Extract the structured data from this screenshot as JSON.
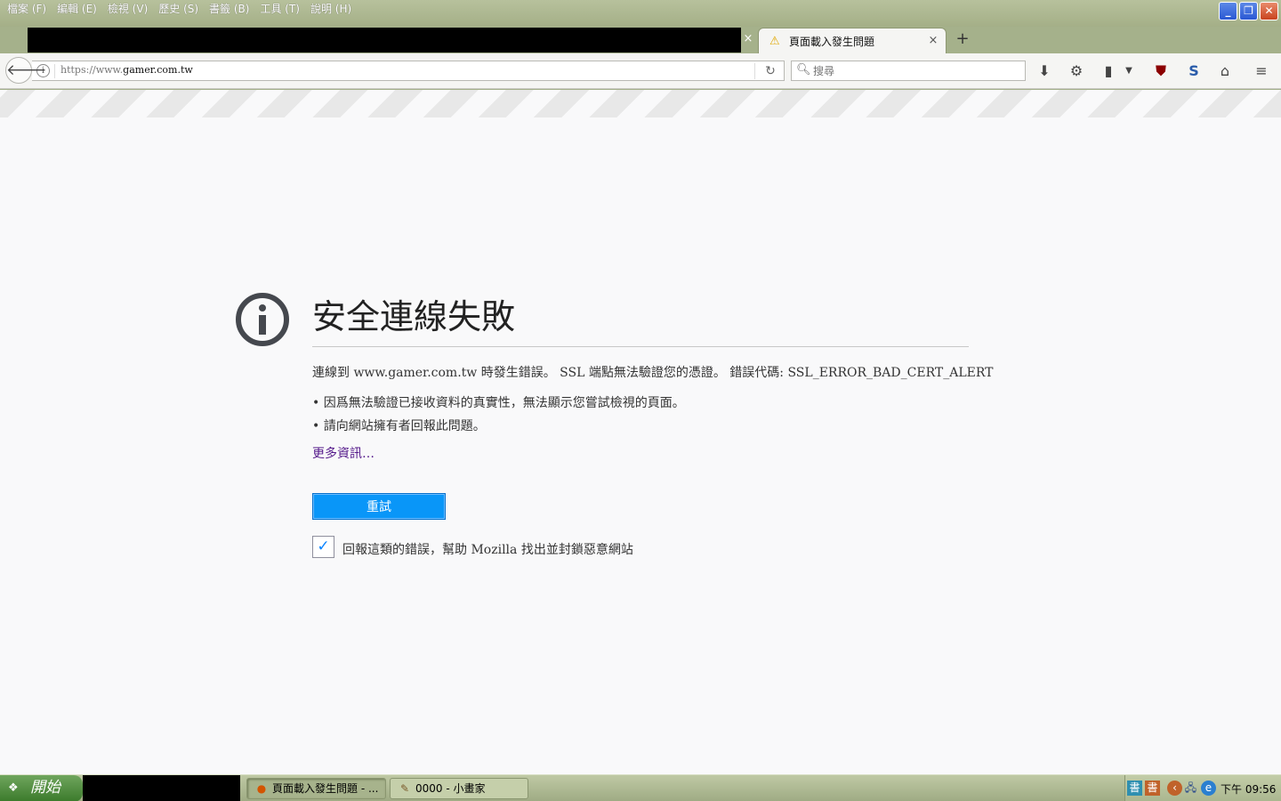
{
  "menu": [
    "檔案 (F)",
    "編輯 (E)",
    "檢視 (V)",
    "歷史 (S)",
    "書籤 (B)",
    "工具 (T)",
    "說明 (H)"
  ],
  "tabs": {
    "active_label": "頁面載入發生問題",
    "close_glyph": "×",
    "new_tab_glyph": "+"
  },
  "navbar": {
    "url_prefix": "https://www.",
    "url_domain": "gamer.com.tw",
    "search_placeholder": "搜尋"
  },
  "error": {
    "title": "安全連線失敗",
    "description": "連線到 www.gamer.com.tw 時發生錯誤。 SSL 端點無法驗證您的憑證。 錯誤代碼: SSL_ERROR_BAD_CERT_ALERT",
    "bullets": [
      "因爲無法驗證已接收資料的真實性，無法顯示您嘗試檢視的頁面。",
      "請向網站擁有者回報此問題。"
    ],
    "more_info": "更多資訊…",
    "retry_label": "重試",
    "report_label": "回報這類的錯誤，幫助 Mozilla 找出並封鎖惡意網站"
  },
  "taskbar": {
    "start_label": "開始",
    "tasks": [
      "頁面載入發生問題 - ...",
      "0000 - 小畫家"
    ],
    "clock": "下午 09:56"
  },
  "icons": {
    "back": "back-arrow-icon",
    "reload": "reload-icon",
    "search": "search-icon",
    "download": "download-icon",
    "menu": "hamburger-menu-icon",
    "home": "home-icon"
  },
  "colors": {
    "retry_button": "#0996f8",
    "error_icon": "#45484e",
    "link_visited": "#551a8b",
    "xp_olive": "#a5b18b"
  }
}
